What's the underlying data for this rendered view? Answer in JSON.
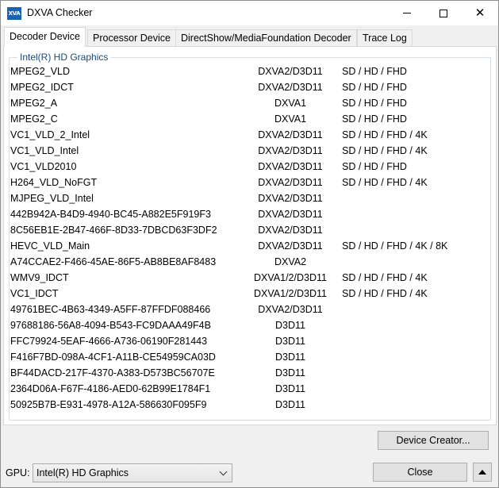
{
  "window": {
    "title": "DXVA Checker",
    "icon_text": "XVA"
  },
  "tabs": [
    {
      "label": "Decoder Device",
      "active": true
    },
    {
      "label": "Processor Device",
      "active": false
    },
    {
      "label": "DirectShow/MediaFoundation Decoder",
      "active": false
    },
    {
      "label": "Trace Log",
      "active": false
    }
  ],
  "group": {
    "title": "Intel(R) HD Graphics"
  },
  "decoders": [
    {
      "name": "MPEG2_VLD",
      "api": "DXVA2/D3D11",
      "res": "SD / HD / FHD"
    },
    {
      "name": "MPEG2_IDCT",
      "api": "DXVA2/D3D11",
      "res": "SD / HD / FHD"
    },
    {
      "name": "MPEG2_A",
      "api": "DXVA1",
      "res": "SD / HD / FHD"
    },
    {
      "name": "MPEG2_C",
      "api": "DXVA1",
      "res": "SD / HD / FHD"
    },
    {
      "name": "VC1_VLD_2_Intel",
      "api": "DXVA2/D3D11",
      "res": "SD / HD / FHD / 4K"
    },
    {
      "name": "VC1_VLD_Intel",
      "api": "DXVA2/D3D11",
      "res": "SD / HD / FHD / 4K"
    },
    {
      "name": "VC1_VLD2010",
      "api": "DXVA2/D3D11",
      "res": "SD / HD / FHD"
    },
    {
      "name": "H264_VLD_NoFGT",
      "api": "DXVA2/D3D11",
      "res": "SD / HD / FHD / 4K"
    },
    {
      "name": "MJPEG_VLD_Intel",
      "api": "DXVA2/D3D11",
      "res": ""
    },
    {
      "name": "442B942A-B4D9-4940-BC45-A882E5F919F3",
      "api": "DXVA2/D3D11",
      "res": ""
    },
    {
      "name": "8C56EB1E-2B47-466F-8D33-7DBCD63F3DF2",
      "api": "DXVA2/D3D11",
      "res": ""
    },
    {
      "name": "HEVC_VLD_Main",
      "api": "DXVA2/D3D11",
      "res": "SD / HD / FHD / 4K / 8K"
    },
    {
      "name": "A74CCAE2-F466-45AE-86F5-AB8BE8AF8483",
      "api": "DXVA2",
      "res": ""
    },
    {
      "name": "WMV9_IDCT",
      "api": "DXVA1/2/D3D11",
      "res": "SD / HD / FHD / 4K"
    },
    {
      "name": "VC1_IDCT",
      "api": "DXVA1/2/D3D11",
      "res": "SD / HD / FHD / 4K"
    },
    {
      "name": "49761BEC-4B63-4349-A5FF-87FFDF088466",
      "api": "DXVA2/D3D11",
      "res": ""
    },
    {
      "name": "97688186-56A8-4094-B543-FC9DAAA49F4B",
      "api": "D3D11",
      "res": ""
    },
    {
      "name": "FFC79924-5EAF-4666-A736-06190F281443",
      "api": "D3D11",
      "res": ""
    },
    {
      "name": "F416F7BD-098A-4CF1-A11B-CE54959CA03D",
      "api": "D3D11",
      "res": ""
    },
    {
      "name": "BF44DACD-217F-4370-A383-D573BC56707E",
      "api": "D3D11",
      "res": ""
    },
    {
      "name": "2364D06A-F67F-4186-AED0-62B99E1784F1",
      "api": "D3D11",
      "res": ""
    },
    {
      "name": "50925B7B-E931-4978-A12A-586630F095F9",
      "api": "D3D11",
      "res": ""
    }
  ],
  "buttons": {
    "device_creator": "Device Creator...",
    "close": "Close"
  },
  "gpu": {
    "label": "GPU:",
    "selected": "Intel(R) HD Graphics"
  },
  "colors": {
    "accent_icon": "#1763b8",
    "group_title": "#1a4a7a"
  }
}
